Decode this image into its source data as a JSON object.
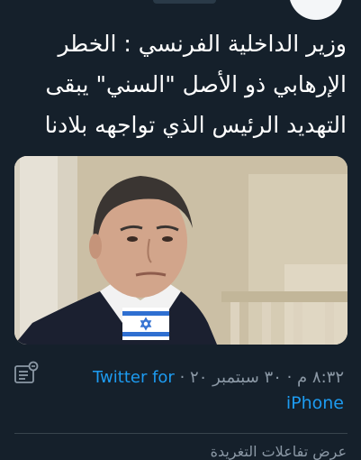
{
  "tweet": {
    "text_line1": "وزير الداخلية الفرنسي : الخطر",
    "text_line2": "الإرهابي ذو الأصل \"السني\" يبقى",
    "text_line3": "التهديد الرئيس الذي تواجهه بلادنا"
  },
  "meta": {
    "time_date": "٨:٣٢ م · ٣٠ سبتمبر ٢٠ ·",
    "via_part1": "Twitter for",
    "via_part2": "iPhone",
    "analytics_icon": "analytics-icon"
  },
  "footer": {
    "partial_text": "عرض تفاعلات التغريدة"
  },
  "colors": {
    "background": "#15202b",
    "link": "#1d9bf0",
    "secondary": "#8b98a5"
  }
}
